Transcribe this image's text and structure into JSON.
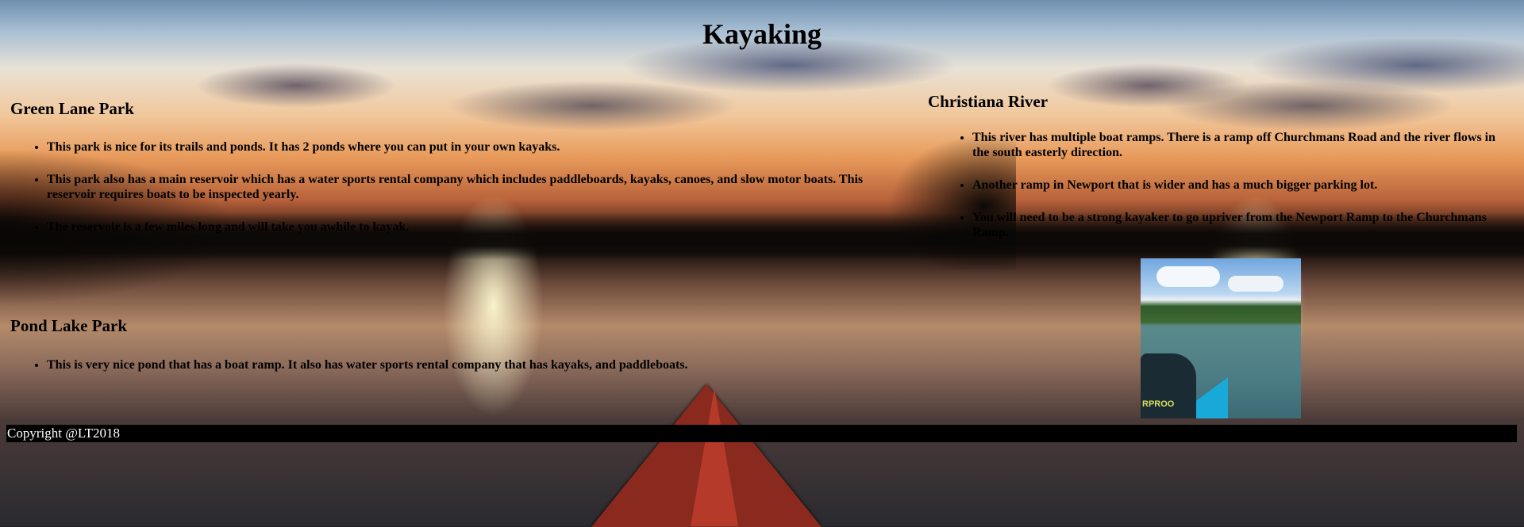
{
  "page": {
    "title": "Kayaking"
  },
  "sections": {
    "green_lane": {
      "heading": "Green Lane Park",
      "items": [
        "This park is nice for its trails and ponds. It has 2 ponds where you can put in your own kayaks.",
        "This park also has a main reservoir which has a water sports rental company which includes paddleboards, kayaks, canoes, and slow motor boats. This reservoir requires boats to be inspected yearly.",
        "The reservoir is a few miles long and will take you awhile to kayak."
      ]
    },
    "pond_park": {
      "heading": "Pond Lake Park",
      "items": [
        "This is very nice pond that has a boat ramp. It also has water sports rental company that has kayaks, and paddleboats."
      ]
    },
    "christiana": {
      "heading": "Christiana River",
      "items": [
        "This river has multiple boat ramps. There is a ramp off Churchmans Road and the river flows in the south easterly direction.",
        "Another ramp in Newport that is wider and has a much bigger parking lot.",
        "You will need to be a strong kayaker to go upriver from the Newport Ramp to the Churchmans Ramp."
      ]
    }
  },
  "images": {
    "river_photo": {
      "icon": "kayak-on-river-photo",
      "gear_text": "RPROO"
    }
  },
  "footer": {
    "copyright": "Copyright @LT2018"
  },
  "colors": {
    "footer_bg": "#000000",
    "footer_text": "#ffffff",
    "text": "#000000"
  }
}
